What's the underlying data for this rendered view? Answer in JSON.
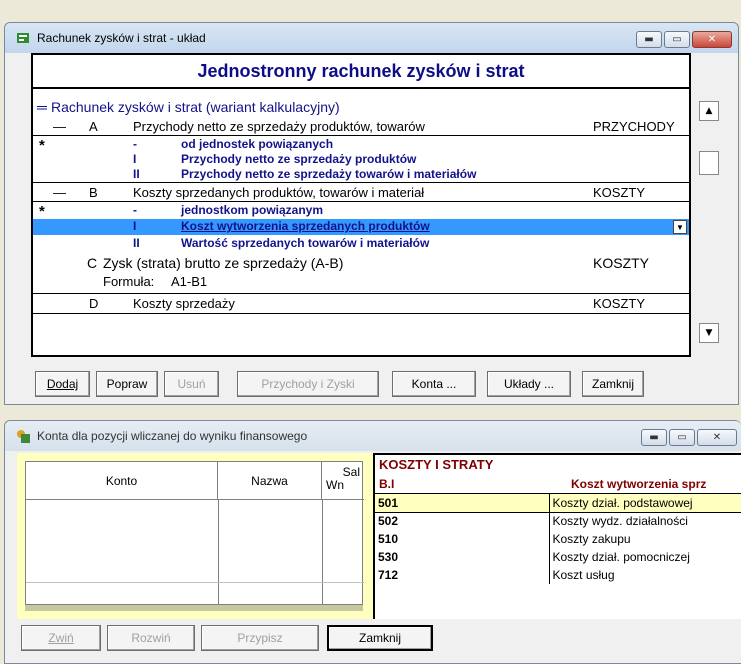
{
  "win1": {
    "title": "Rachunek zysków i strat - układ",
    "header": "Jednostronny rachunek zysków i strat",
    "root": "Rachunek zysków i strat (wariant kalkulacyjny)",
    "rows": [
      {
        "sym": "—",
        "col1": "A",
        "text": "Przychody netto ze sprzedaży produktów, towarów",
        "type": "PRZYCHODY"
      },
      {
        "sym": "*",
        "col1": "-",
        "text": "od jednostek powiązanych"
      },
      {
        "col1": "I",
        "text": "Przychody netto ze sprzedaży produktów"
      },
      {
        "col1": "II",
        "text": "Przychody netto ze sprzedaży towarów i materiałów"
      },
      {
        "sym": "—",
        "col1": "B",
        "text": "Koszty sprzedanych produktów, towarów i materiał",
        "type": "KOSZTY"
      },
      {
        "sym": "*",
        "col1": "-",
        "text": "jednostkom powiązanym"
      },
      {
        "col1": "I",
        "text": "Koszt wytworzenia sprzedanych produktów"
      },
      {
        "col1": "II",
        "text": "Wartość sprzedanych towarów i materiałów"
      },
      {
        "col1": "C",
        "text": "Zysk (strata) brutto ze sprzedaży (A-B)",
        "type": "KOSZTY"
      },
      {
        "formula_label": "Formuła:",
        "formula": "A1-B1"
      },
      {
        "col1": "D",
        "text": "Koszty sprzedaży",
        "type": "KOSZTY"
      }
    ],
    "buttons": {
      "dodaj": "Dodaj",
      "popraw": "Popraw",
      "usun": "Usuń",
      "przychody": "Przychody i Zyski",
      "konta": "Konta ...",
      "uklady": "Układy ...",
      "zamknij": "Zamknij"
    }
  },
  "win2": {
    "title": "Konta dla pozycji wliczanej do wyniku finansowego",
    "cols": {
      "konto": "Konto",
      "nazwa": "Nazwa",
      "sal": "Sal",
      "wn": "Wn"
    },
    "group_title": "KOSZTY I STRATY",
    "code": "B.I",
    "code_name": "Koszt wytworzenia sprz",
    "accounts": [
      {
        "konto": "501",
        "nazwa": "Koszty dział. podstawowej"
      },
      {
        "konto": "502",
        "nazwa": "Koszty wydz. działalności"
      },
      {
        "konto": "510",
        "nazwa": "Koszty zakupu"
      },
      {
        "konto": "530",
        "nazwa": "Koszty dział. pomocniczej"
      },
      {
        "konto": "712",
        "nazwa": "Koszt usług"
      }
    ],
    "buttons": {
      "zwin": "Zwiń",
      "rozwin": "Rozwiń",
      "przypisz": "Przypisz",
      "zamknij": "Zamknij"
    }
  },
  "colors": {
    "header_blue": "#0d0d86",
    "selection": "#3399ff",
    "highlight_yellow": "#ffffc0",
    "dark_red": "#800000"
  }
}
